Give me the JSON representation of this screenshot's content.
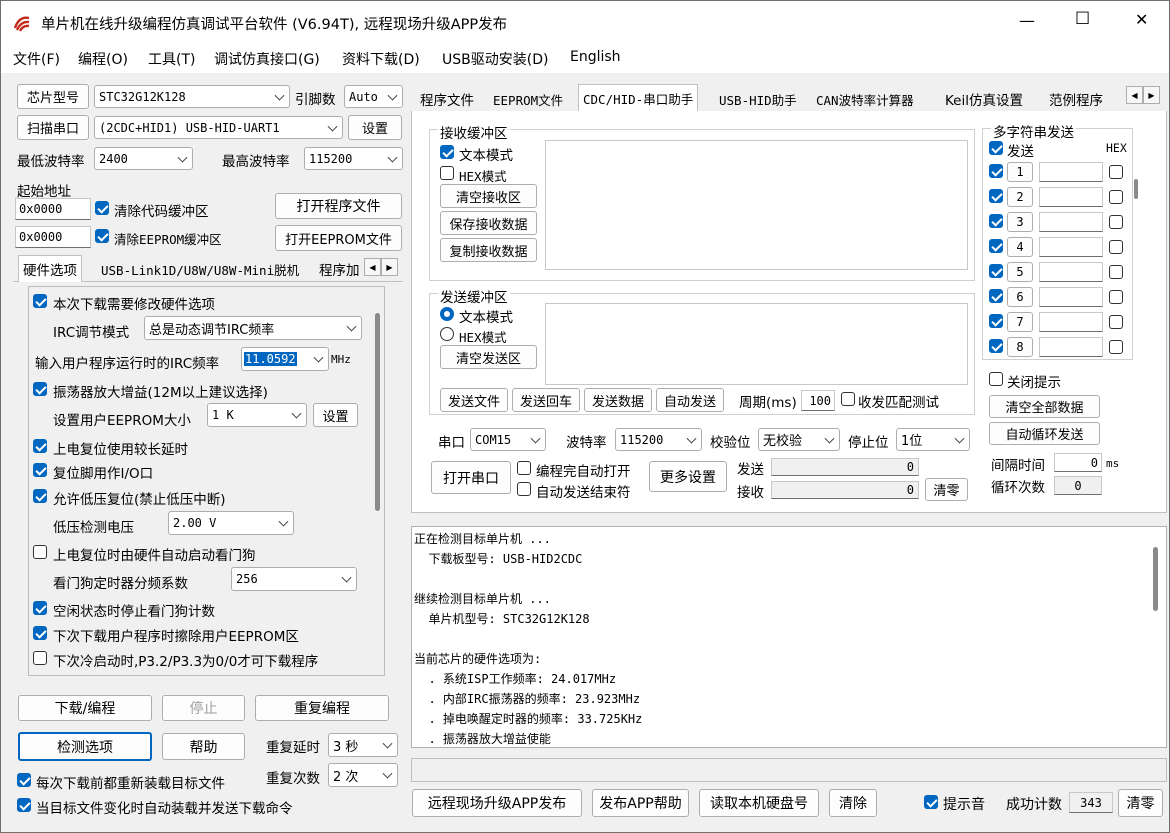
{
  "window": {
    "title": "单片机在线升级编程仿真调试平台软件 (V6.94T), 远程现场升级APP发布",
    "min": "—",
    "max": "☐",
    "close": "✕"
  },
  "menu": [
    "文件(F)",
    "编程(O)",
    "工具(T)",
    "调试仿真接口(G)",
    "资料下载(D)",
    "USB驱动安装(D)",
    "English"
  ],
  "left": {
    "chip_type_btn": "芯片型号",
    "chip_type": "STC32G12K128",
    "pin_label": "引脚数",
    "pin": "Auto",
    "scan_btn": "扫描串口",
    "port": "(2CDC+HID1) USB-HID-UART1",
    "settings_btn": "设置",
    "min_baud_label": "最低波特率",
    "min_baud": "2400",
    "max_baud_label": "最高波特率",
    "max_baud": "115200",
    "start_addr_label": "起始地址",
    "addr1": "0x0000",
    "clear_code": "清除代码缓冲区",
    "open_prog": "打开程序文件",
    "addr2": "0x0000",
    "clear_eeprom": "清除EEPROM缓冲区",
    "open_eeprom": "打开EEPROM文件",
    "tabs": [
      "硬件选项",
      "USB-Link1D/U8W/U8W-Mini脱机",
      "程序加"
    ],
    "hw": {
      "opt1": "本次下载需要修改硬件选项",
      "irc_mode_label": "IRC调节模式",
      "irc_mode": "总是动态调节IRC频率",
      "freq_label": "输入用户程序运行时的IRC频率",
      "freq": "11.0592",
      "freq_unit": "MHz",
      "opt2": "振荡器放大增益(12M以上建议选择)",
      "eeprom_label": "设置用户EEPROM大小",
      "eeprom": "1  K",
      "eeprom_btn": "设置",
      "opt3": "上电复位使用较长延时",
      "opt4": "复位脚用作I/O口",
      "opt5": "允许低压复位(禁止低压中断)",
      "lv_label": "低压检测电压",
      "lv": "2.00 V",
      "opt6": "上电复位时由硬件自动启动看门狗",
      "wd_label": "看门狗定时器分频系数",
      "wd": "256",
      "opt7": "空闲状态时停止看门狗计数",
      "opt8": "下次下载用户程序时擦除用户EEPROM区",
      "opt9": "下次冷启动时,P3.2/P3.3为0/0才可下载程序"
    },
    "download_btn": "下载/编程",
    "stop_btn": "停止",
    "reprog_btn": "重复编程",
    "check_btn": "检测选项",
    "help_btn": "帮助",
    "delay_label": "重复延时",
    "delay": "3 秒",
    "count_label": "重复次数",
    "count": "2 次",
    "reload": "每次下载前都重新装载目标文件",
    "auto_reload": "当目标文件变化时自动装载并发送下载命令"
  },
  "right": {
    "tabs": [
      "程序文件",
      "EEPROM文件",
      "CDC/HID-串口助手",
      "USB-HID助手",
      "CAN波特率计算器",
      "Keil仿真设置",
      "范例程序"
    ],
    "recv": {
      "title": "接收缓冲区",
      "text_mode": "文本模式",
      "hex_mode": "HEX模式",
      "clear": "清空接收区",
      "save": "保存接收数据",
      "copy": "复制接收数据"
    },
    "send": {
      "title": "发送缓冲区",
      "text_mode": "文本模式",
      "hex_mode": "HEX模式",
      "clear": "清空发送区",
      "send_file": "发送文件",
      "send_cr": "发送回车",
      "send_data": "发送数据",
      "auto_send": "自动发送",
      "period_label": "周期(ms)",
      "period": "100",
      "match_test": "收发匹配测试"
    },
    "serial": {
      "port_label": "串口",
      "port": "COM15",
      "baud_label": "波特率",
      "baud": "115200",
      "parity_label": "校验位",
      "parity": "无校验",
      "stop_label": "停止位",
      "stop": "1位",
      "open": "打开串口",
      "auto_open": "编程完自动打开",
      "auto_end": "自动发送结束符",
      "more": "更多设置",
      "tx_label": "发送",
      "tx": "0",
      "rx_label": "接收",
      "rx": "0",
      "clear": "清零"
    },
    "multi": {
      "title": "多字符串发送",
      "send": "发送",
      "hex": "HEX",
      "rows": [
        "1",
        "2",
        "3",
        "4",
        "5",
        "6",
        "7",
        "8"
      ],
      "close_tip": "关闭提示",
      "clear_all": "清空全部数据",
      "auto_loop": "自动循环发送",
      "interval_label": "间隔时间",
      "interval": "0",
      "interval_unit": "ms",
      "loop_label": "循环次数",
      "loop": "0"
    },
    "log": [
      "正在检测目标单片机 ...",
      "  下载板型号: USB-HID2CDC",
      "",
      "继续检测目标单片机 ...",
      "  单片机型号: STC32G12K128",
      "",
      "当前芯片的硬件选项为:",
      "  . 系统ISP工作频率: 24.017MHz",
      "  . 内部IRC振荡器的频率: 23.923MHz",
      "  . 掉电唤醒定时器的频率: 33.725KHz",
      "  . 振荡器放大增益使能"
    ],
    "bottom": {
      "publish": "远程现场升级APP发布",
      "publish_help": "发布APP帮助",
      "read_disk": "读取本机硬盘号",
      "clear": "清除",
      "beep": "提示音",
      "success_label": "成功计数",
      "success": "343",
      "clear2": "清零"
    }
  },
  "colors": {
    "accent": "#0067c0",
    "title_icon": "#c42b1c"
  }
}
